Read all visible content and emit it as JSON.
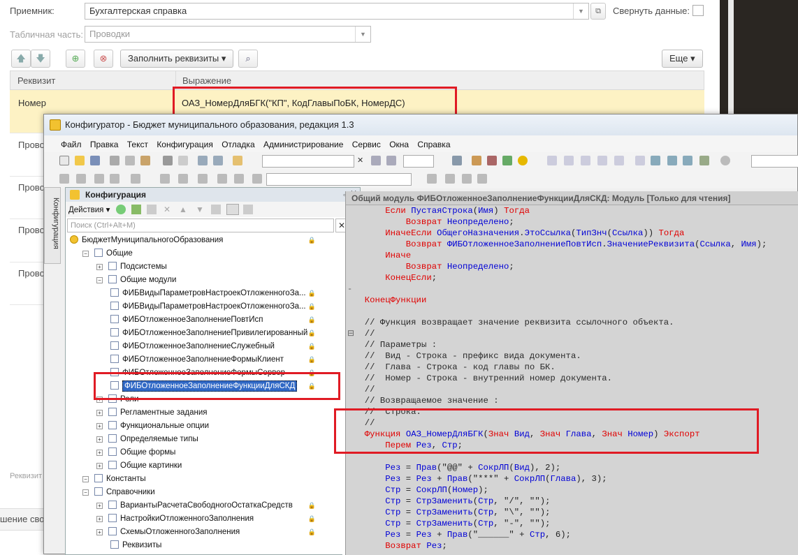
{
  "form": {
    "receiver_label": "Приемник:",
    "receiver_value": "Бухгалтерская справка",
    "collapse_label": "Свернуть данные:",
    "tabpart_label": "Табличная часть:",
    "tabpart_value": "Проводки",
    "fill_button": "Заполнить реквизиты",
    "more_button": "Еще",
    "col_requisite": "Реквизит",
    "col_expression": "Выражение",
    "row_name": "Номер",
    "row_expression": "ОАЗ_НомерДляБГК(\"КП\", КодГлавыПоБК, НомерДС)",
    "left_rows": [
      "Прово",
      "Прово",
      "Прово",
      "Прово"
    ],
    "bottom_hint": "Реквизит",
    "bottom_text": "шение сво"
  },
  "configurator": {
    "title": "Конфигуратор - Бюджет муниципального образования, редакция 1.3",
    "menu": [
      "Файл",
      "Правка",
      "Текст",
      "Конфигурация",
      "Отладка",
      "Администрирование",
      "Сервис",
      "Окна",
      "Справка"
    ],
    "side_tab": "Конфигурация",
    "panel_title": "Конфигурация",
    "actions_label": "Действия",
    "search_placeholder": "Поиск (Ctrl+Alt+M)",
    "tree": [
      {
        "label": "БюджетМуниципальногоОбразования",
        "level": 0,
        "lock": true
      },
      {
        "label": "Общие",
        "level": 1
      },
      {
        "label": "Подсистемы",
        "level": 2
      },
      {
        "label": "Общие модули",
        "level": 2
      },
      {
        "label": "ФИБВидыПараметровНастроекОтложенногоЗа...",
        "level": 3,
        "lock": true
      },
      {
        "label": "ФИБВидыПараметровНастроекОтложенногоЗа...",
        "level": 3,
        "lock": true
      },
      {
        "label": "ФИБОтложенноеЗаполнениеПовтИсп",
        "level": 3,
        "lock": true
      },
      {
        "label": "ФИБОтложенноеЗаполнениеПривилегированный",
        "level": 3,
        "lock": true
      },
      {
        "label": "ФИБОтложенноеЗаполнениеСлужебный",
        "level": 3,
        "lock": true
      },
      {
        "label": "ФИБОтложенноеЗаполнениеФормыКлиент",
        "level": 3,
        "lock": true
      },
      {
        "label": "ФИБОтложенноеЗаполнениеФормыСервер",
        "level": 3,
        "lock": true
      },
      {
        "label": "ФИБОтложенноеЗаполнениеФункцииДляСКД",
        "level": 3,
        "lock": true,
        "selected": true
      },
      {
        "label": "Роли",
        "level": 2
      },
      {
        "label": "Регламентные задания",
        "level": 2
      },
      {
        "label": "Функциональные опции",
        "level": 2
      },
      {
        "label": "Определяемые типы",
        "level": 2
      },
      {
        "label": "Общие формы",
        "level": 2
      },
      {
        "label": "Общие картинки",
        "level": 2
      },
      {
        "label": "Константы",
        "level": 1
      },
      {
        "label": "Справочники",
        "level": 1
      },
      {
        "label": "ВариантыРасчетаСвободногоОстаткаСредств",
        "level": 2,
        "lock": true
      },
      {
        "label": "НастройкиОтложенногоЗаполнения",
        "level": 2,
        "lock": true
      },
      {
        "label": "СхемыОтложенногоЗаполнения",
        "level": 2,
        "lock": true
      },
      {
        "label": "Реквизиты",
        "level": 3
      }
    ],
    "code_title": "Общий модуль ФИБОтложенноеЗаполнениеФункцииДляСКД: Модуль [Только для чтения]"
  },
  "colors": {
    "highlight_red": "#e01b24",
    "selected_row": "#fdf2c4",
    "code_bg": "#d4d4d4",
    "keyword": "#e00000",
    "identifier": "#0000d6"
  }
}
